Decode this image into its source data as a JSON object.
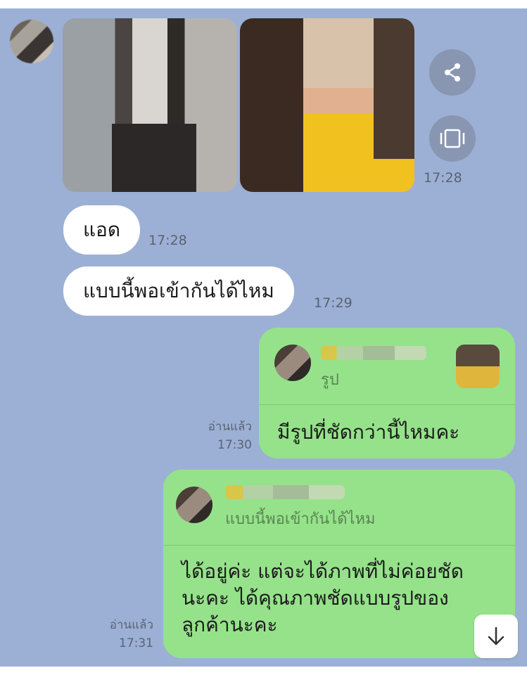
{
  "messages": {
    "img_time": "17:28",
    "msg1_text": "แอด",
    "msg1_time": "17:28",
    "msg2_text": "แบบนี้พอเข้ากันได้ไหม",
    "msg2_time": "17:29",
    "reply1": {
      "quoted_sub": "รูป",
      "text": "มีรูปที่ชัดกว่านี้ไหมคะ",
      "read_label": "อ่านแล้ว",
      "time": "17:30"
    },
    "reply2": {
      "quoted_sub": "แบบนี้พอเข้ากันได้ไหม",
      "text_lines": [
        "ได้อยู่ค่ะ แต่จะได้ภาพที่ไม่ค่อยชัด",
        "นะคะ ได้คุณภาพชัดแบบรูปของ",
        "ลูกค้านะคะ"
      ],
      "read_label": "อ่านแล้ว",
      "time": "17:31"
    }
  },
  "icons": {
    "share": "share-icon",
    "view_all": "gallery-icon",
    "scroll_down": "arrow-down-icon"
  },
  "colors": {
    "background": "#9cb0d6",
    "outgoing_bubble": "#95e28a",
    "incoming_bubble": "#ffffff"
  }
}
